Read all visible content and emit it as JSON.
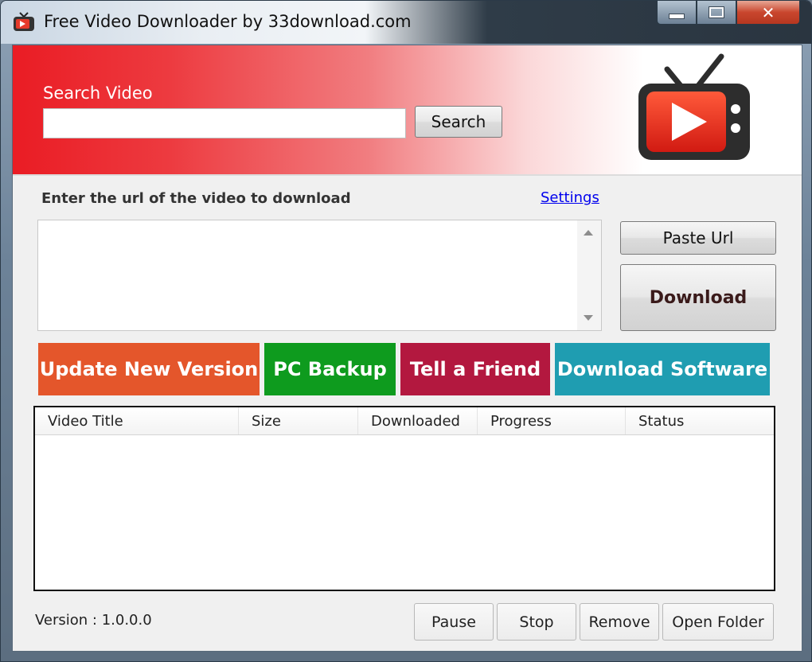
{
  "window": {
    "title": "Free Video Downloader by 33download.com"
  },
  "banner": {
    "search_label": "Search Video",
    "search_value": "",
    "search_button": "Search"
  },
  "url_section": {
    "label": "Enter the url of the video to download",
    "settings_link": "Settings",
    "url_value": "",
    "paste_button": "Paste Url",
    "download_button": "Download"
  },
  "promos": [
    {
      "label": "Update New Version",
      "color": "#e4562b"
    },
    {
      "label": "PC Backup",
      "color": "#0e9b1e"
    },
    {
      "label": "Tell a Friend",
      "color": "#b3183f"
    },
    {
      "label": "Download Software",
      "color": "#1f9db1"
    }
  ],
  "download_list": {
    "columns": [
      "Video Title",
      "Size",
      "Downloaded",
      "Progress",
      "Status"
    ],
    "rows": []
  },
  "footer": {
    "version": "Version : 1.0.0.0",
    "pause_button": "Pause",
    "stop_button": "Stop",
    "remove_button": "Remove",
    "open_folder_button": "Open Folder"
  },
  "icons": {
    "app": "tv-play-icon",
    "logo": "tv-play-logo"
  },
  "colors": {
    "brand_red": "#ea1c24",
    "link": "#0000ee"
  }
}
